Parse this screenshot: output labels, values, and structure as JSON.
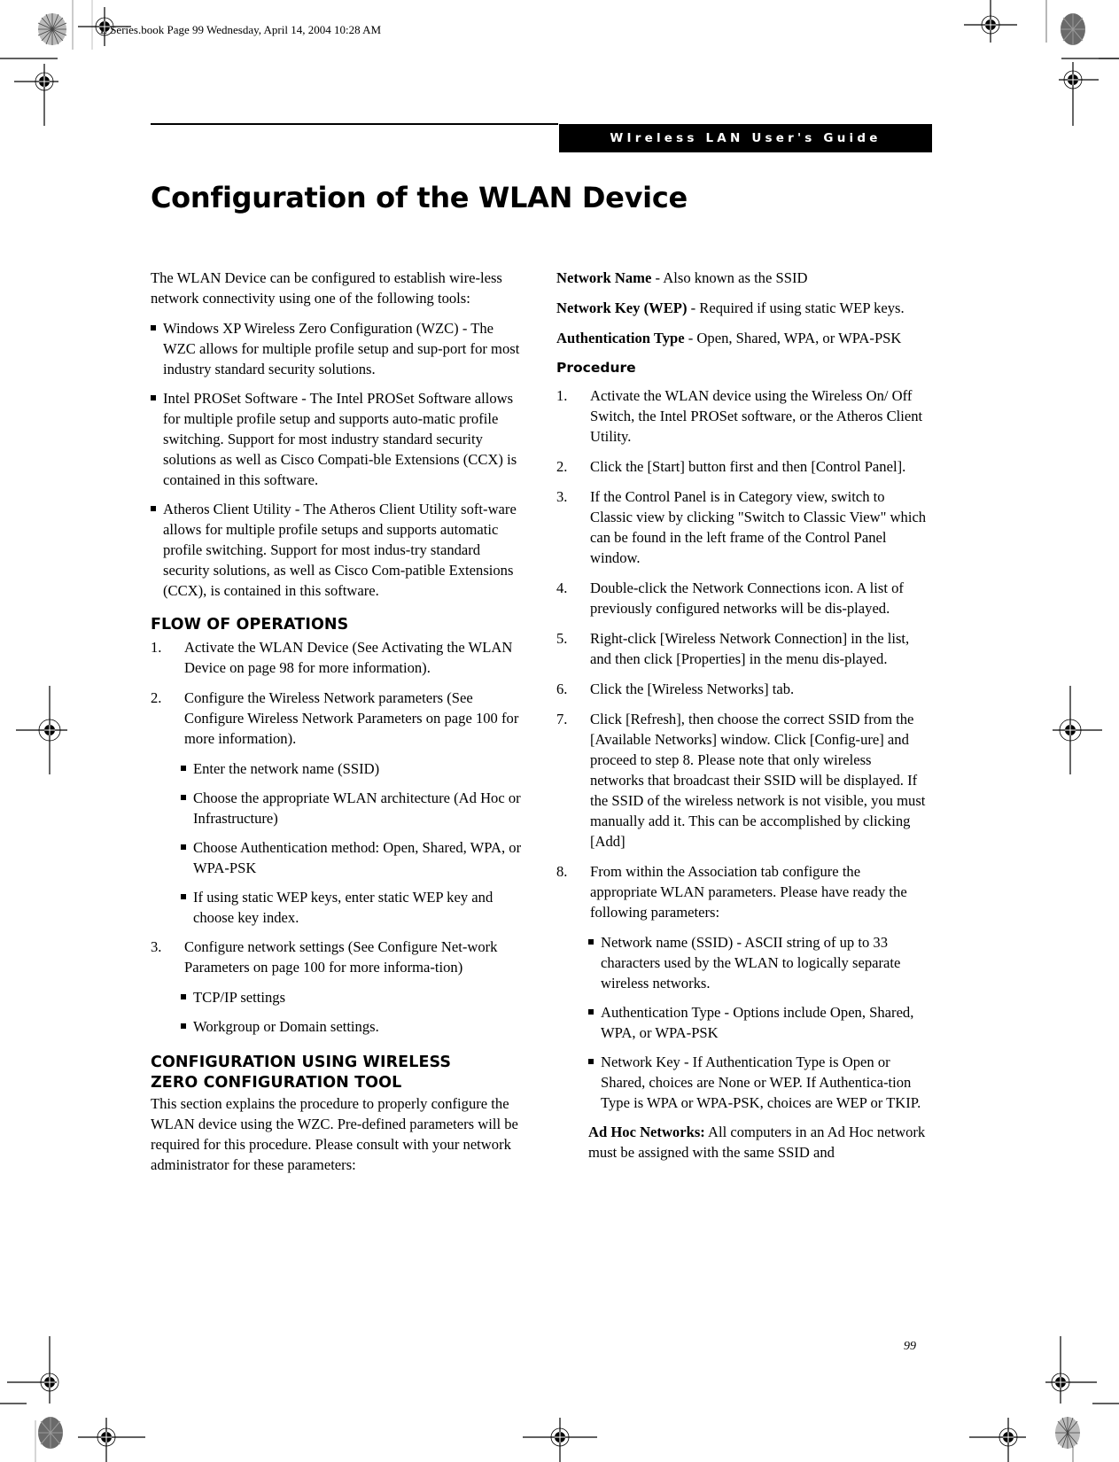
{
  "slug": "E Series.book  Page 99  Wednesday, April 14, 2004  10:28 AM",
  "header": {
    "running_title": "WIreless LAN User's Guide"
  },
  "page_title": "Configuration of the WLAN Device",
  "left": {
    "intro": "The WLAN Device can be configured to establish wire-less network connectivity using one of the following tools:",
    "tools": [
      "Windows XP Wireless Zero Configuration (WZC) - The WZC allows for multiple profile setup and sup-port for most industry standard security solutions.",
      "Intel PROSet Software - The Intel PROSet Software allows for multiple profile setup and supports auto-matic profile switching. Support for most industry standard security solutions as well as Cisco Compati-ble Extensions (CCX) is contained in this software.",
      "Atheros Client Utility - The Atheros Client Utility soft-ware allows for multiple profile setups and supports automatic profile switching. Support for most indus-try standard security solutions, as well as Cisco Com-patible Extensions (CCX), is contained in this software."
    ],
    "flow_heading": "FLOW OF OPERATIONS",
    "flow": [
      {
        "n": "1.",
        "text": "Activate the WLAN Device (See Activating the WLAN Device on page 98 for more information)."
      },
      {
        "n": "2.",
        "text": "Configure the Wireless Network parameters (See Configure Wireless Network Parameters on page 100 for more information)."
      },
      {
        "n": "3.",
        "text": "Configure network settings (See Configure Net-work Parameters on page 100 for more informa-tion)"
      }
    ],
    "flow2_bullets": [
      "Enter the network name (SSID)",
      "Choose the appropriate WLAN architecture (Ad Hoc or Infrastructure)",
      "Choose Authentication method: Open, Shared, WPA, or WPA-PSK",
      "If using static WEP keys, enter static WEP key and choose key index."
    ],
    "flow3_bullets": [
      "TCP/IP settings",
      "Workgroup or Domain settings."
    ],
    "wzc_heading_1": "CONFIGURATION USING WIRELESS",
    "wzc_heading_2": "ZERO CONFIGURATION TOOL",
    "wzc_text": "This section explains the procedure to properly configure the WLAN device using the WZC. Pre-defined parameters will be required for this procedure. Please consult with your network administrator for these parameters:"
  },
  "right": {
    "params": [
      {
        "term": "Network Name",
        "desc": " - Also known as the SSID"
      },
      {
        "term": "Network Key (WEP)",
        "desc": " - Required if using static WEP keys."
      },
      {
        "term": "Authentication Type",
        "desc": " - Open, Shared, WPA, or WPA-PSK"
      }
    ],
    "procedure_heading": "Procedure",
    "steps": [
      {
        "n": "1.",
        "text": "Activate the WLAN device using the Wireless On/ Off Switch, the Intel PROSet software, or the Atheros Client Utility."
      },
      {
        "n": "2.",
        "text": "Click the [Start] button first and then [Control Panel]."
      },
      {
        "n": "3.",
        "text": "If the Control Panel is in Category view, switch to Classic view by clicking \"Switch to Classic View\" which can be found in the left frame of the Control Panel window."
      },
      {
        "n": "4.",
        "text": "Double-click the Network Connections icon. A list of previously configured networks will be dis-played."
      },
      {
        "n": "5.",
        "text": "Right-click [Wireless Network Connection] in the list, and then click [Properties] in the menu dis-played."
      },
      {
        "n": "6.",
        "text": "Click the [Wireless Networks] tab."
      },
      {
        "n": "7.",
        "text": "Click [Refresh], then choose the correct SSID from the [Available Networks] window. Click [Config-ure] and proceed to step 8. Please note that only wireless networks that broadcast their SSID will be displayed. If the SSID of the wireless network is not visible, you must manually add it. This can be accomplished by clicking [Add]"
      },
      {
        "n": "8.",
        "text": "From within the Association tab configure the appropriate WLAN parameters. Please have ready the following parameters:"
      }
    ],
    "step8_bullets": [
      "Network name (SSID) - ASCII string of up to 33 characters used by the WLAN to logically separate wireless networks.",
      "Authentication Type - Options include Open, Shared, WPA, or WPA-PSK",
      "Network Key - If Authentication Type is Open or Shared, choices are None or WEP. If Authentica-tion Type is WPA or WPA-PSK, choices are WEP or TKIP."
    ],
    "adhoc_term": "Ad Hoc Networks:",
    "adhoc_text": " All computers in an Ad Hoc network must be assigned with the same SSID and"
  },
  "page_number": "99",
  "icons": {
    "registration": "registration-crosshair-icon",
    "star_target": "color-star-target-icon"
  }
}
